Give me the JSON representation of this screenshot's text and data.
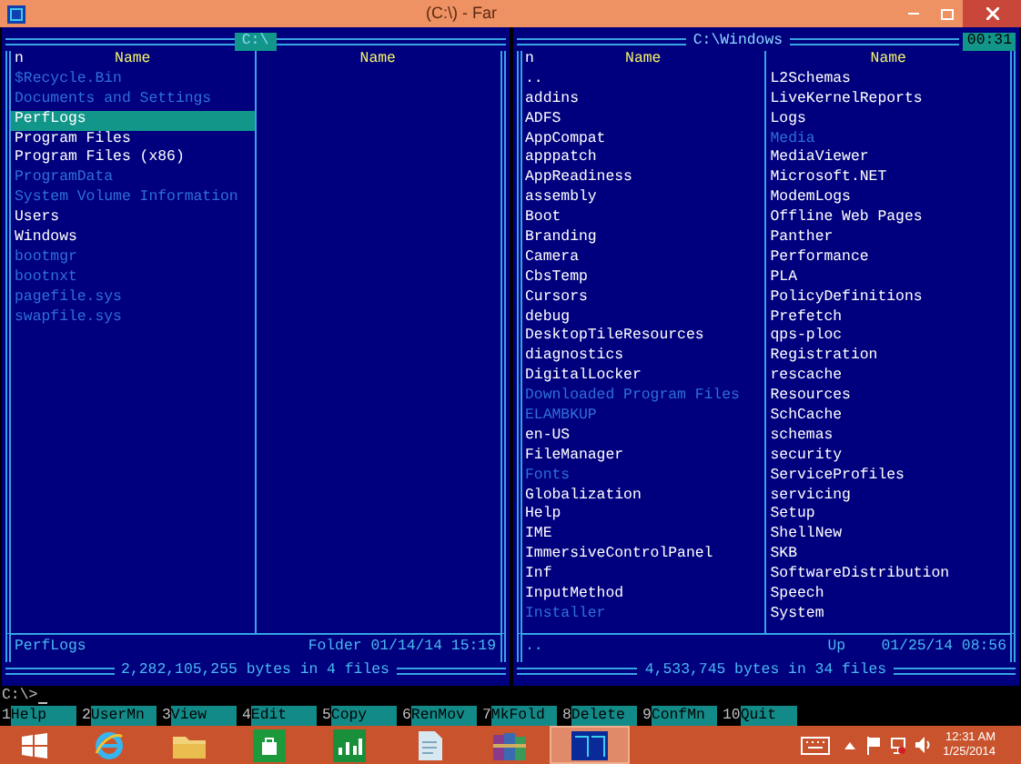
{
  "window": {
    "title": "(C:\\) - Far"
  },
  "panels": [
    {
      "path": "C:\\",
      "columns": [
        {
          "header": "Name",
          "mark": "n",
          "files": [
            {
              "name": "$Recycle.Bin",
              "kind": "hidden",
              "selected": false
            },
            {
              "name": "Documents and Settings",
              "kind": "hidden",
              "selected": false
            },
            {
              "name": "PerfLogs",
              "kind": "normal",
              "selected": true
            },
            {
              "name": "Program Files",
              "kind": "normal",
              "selected": false
            },
            {
              "name": "Program Files (x86)",
              "kind": "normal",
              "selected": false
            },
            {
              "name": "ProgramData",
              "kind": "hidden",
              "selected": false
            },
            {
              "name": "System Volume Information",
              "kind": "hidden",
              "selected": false
            },
            {
              "name": "Users",
              "kind": "normal",
              "selected": false
            },
            {
              "name": "Windows",
              "kind": "normal",
              "selected": false
            },
            {
              "name": "bootmgr",
              "kind": "hidden",
              "selected": false
            },
            {
              "name": "bootnxt",
              "kind": "hidden",
              "selected": false
            },
            {
              "name": "pagefile.sys",
              "kind": "hidden",
              "selected": false
            },
            {
              "name": "swapfile.sys",
              "kind": "hidden",
              "selected": false
            }
          ]
        },
        {
          "header": "Name"
        }
      ],
      "status": {
        "name": "PerfLogs",
        "info": "Folder 01/14/14 15:19"
      },
      "summary": "2,282,105,255 bytes in 4 files"
    },
    {
      "path": "C:\\Windows",
      "clock": "00:31",
      "columns": [
        {
          "header": "Name",
          "mark": "n",
          "files": [
            {
              "name": "..",
              "kind": "normal",
              "selected": false
            },
            {
              "name": "addins",
              "kind": "normal",
              "selected": false
            },
            {
              "name": "ADFS",
              "kind": "normal",
              "selected": false
            },
            {
              "name": "AppCompat",
              "kind": "normal",
              "selected": false
            },
            {
              "name": "apppatch",
              "kind": "normal",
              "selected": false
            },
            {
              "name": "AppReadiness",
              "kind": "normal",
              "selected": false
            },
            {
              "name": "assembly",
              "kind": "normal",
              "selected": false
            },
            {
              "name": "Boot",
              "kind": "normal",
              "selected": false
            },
            {
              "name": "Branding",
              "kind": "normal",
              "selected": false
            },
            {
              "name": "Camera",
              "kind": "normal",
              "selected": false
            },
            {
              "name": "CbsTemp",
              "kind": "normal",
              "selected": false
            },
            {
              "name": "Cursors",
              "kind": "normal",
              "selected": false
            },
            {
              "name": "debug",
              "kind": "normal",
              "selected": false
            },
            {
              "name": "DesktopTileResources",
              "kind": "normal",
              "selected": false
            },
            {
              "name": "diagnostics",
              "kind": "normal",
              "selected": false
            },
            {
              "name": "DigitalLocker",
              "kind": "normal",
              "selected": false
            },
            {
              "name": "Downloaded Program Files",
              "kind": "hidden",
              "selected": false
            },
            {
              "name": "ELAMBKUP",
              "kind": "hidden",
              "selected": false
            },
            {
              "name": "en-US",
              "kind": "normal",
              "selected": false
            },
            {
              "name": "FileManager",
              "kind": "normal",
              "selected": false
            },
            {
              "name": "Fonts",
              "kind": "hidden",
              "selected": false
            },
            {
              "name": "Globalization",
              "kind": "normal",
              "selected": false
            },
            {
              "name": "Help",
              "kind": "normal",
              "selected": false
            },
            {
              "name": "IME",
              "kind": "normal",
              "selected": false
            },
            {
              "name": "ImmersiveControlPanel",
              "kind": "normal",
              "selected": false
            },
            {
              "name": "Inf",
              "kind": "normal",
              "selected": false
            },
            {
              "name": "InputMethod",
              "kind": "normal",
              "selected": false
            },
            {
              "name": "Installer",
              "kind": "hidden",
              "selected": false
            }
          ]
        },
        {
          "header": "Name",
          "files": [
            {
              "name": "L2Schemas",
              "kind": "normal",
              "selected": false
            },
            {
              "name": "LiveKernelReports",
              "kind": "normal",
              "selected": false
            },
            {
              "name": "Logs",
              "kind": "normal",
              "selected": false
            },
            {
              "name": "Media",
              "kind": "hidden",
              "selected": false
            },
            {
              "name": "MediaViewer",
              "kind": "normal",
              "selected": false
            },
            {
              "name": "Microsoft.NET",
              "kind": "normal",
              "selected": false
            },
            {
              "name": "ModemLogs",
              "kind": "normal",
              "selected": false
            },
            {
              "name": "Offline Web Pages",
              "kind": "normal",
              "selected": false
            },
            {
              "name": "Panther",
              "kind": "normal",
              "selected": false
            },
            {
              "name": "Performance",
              "kind": "normal",
              "selected": false
            },
            {
              "name": "PLA",
              "kind": "normal",
              "selected": false
            },
            {
              "name": "PolicyDefinitions",
              "kind": "normal",
              "selected": false
            },
            {
              "name": "Prefetch",
              "kind": "normal",
              "selected": false
            },
            {
              "name": "qps-ploc",
              "kind": "normal",
              "selected": false
            },
            {
              "name": "Registration",
              "kind": "normal",
              "selected": false
            },
            {
              "name": "rescache",
              "kind": "normal",
              "selected": false
            },
            {
              "name": "Resources",
              "kind": "normal",
              "selected": false
            },
            {
              "name": "SchCache",
              "kind": "normal",
              "selected": false
            },
            {
              "name": "schemas",
              "kind": "normal",
              "selected": false
            },
            {
              "name": "security",
              "kind": "normal",
              "selected": false
            },
            {
              "name": "ServiceProfiles",
              "kind": "normal",
              "selected": false
            },
            {
              "name": "servicing",
              "kind": "normal",
              "selected": false
            },
            {
              "name": "Setup",
              "kind": "normal",
              "selected": false
            },
            {
              "name": "ShellNew",
              "kind": "normal",
              "selected": false
            },
            {
              "name": "SKB",
              "kind": "normal",
              "selected": false
            },
            {
              "name": "SoftwareDistribution",
              "kind": "normal",
              "selected": false
            },
            {
              "name": "Speech",
              "kind": "normal",
              "selected": false
            },
            {
              "name": "System",
              "kind": "normal",
              "selected": false
            }
          ]
        }
      ],
      "status": {
        "name": "..",
        "info": "Up    01/25/14 08:56"
      },
      "summary": "4,533,745 bytes in 34 files"
    }
  ],
  "command_line": "C:\\>",
  "keybar": [
    {
      "key": "1",
      "label": "Help"
    },
    {
      "key": "2",
      "label": "UserMn"
    },
    {
      "key": "3",
      "label": "View"
    },
    {
      "key": "4",
      "label": "Edit"
    },
    {
      "key": "5",
      "label": "Copy"
    },
    {
      "key": "6",
      "label": "RenMov"
    },
    {
      "key": "7",
      "label": "MkFold"
    },
    {
      "key": "8",
      "label": "Delete"
    },
    {
      "key": "9",
      "label": "ConfMn"
    },
    {
      "key": "10",
      "label": "Quit"
    }
  ],
  "taskbar": {
    "apps": [
      {
        "kind": "ie",
        "selected": false
      },
      {
        "kind": "folder",
        "selected": false
      },
      {
        "kind": "store",
        "selected": false
      },
      {
        "kind": "chart",
        "selected": false
      },
      {
        "kind": "notepad",
        "selected": false
      },
      {
        "kind": "archive",
        "selected": false
      },
      {
        "kind": "far",
        "selected": true
      }
    ],
    "time": "12:31 AM",
    "date": "1/25/2014"
  }
}
